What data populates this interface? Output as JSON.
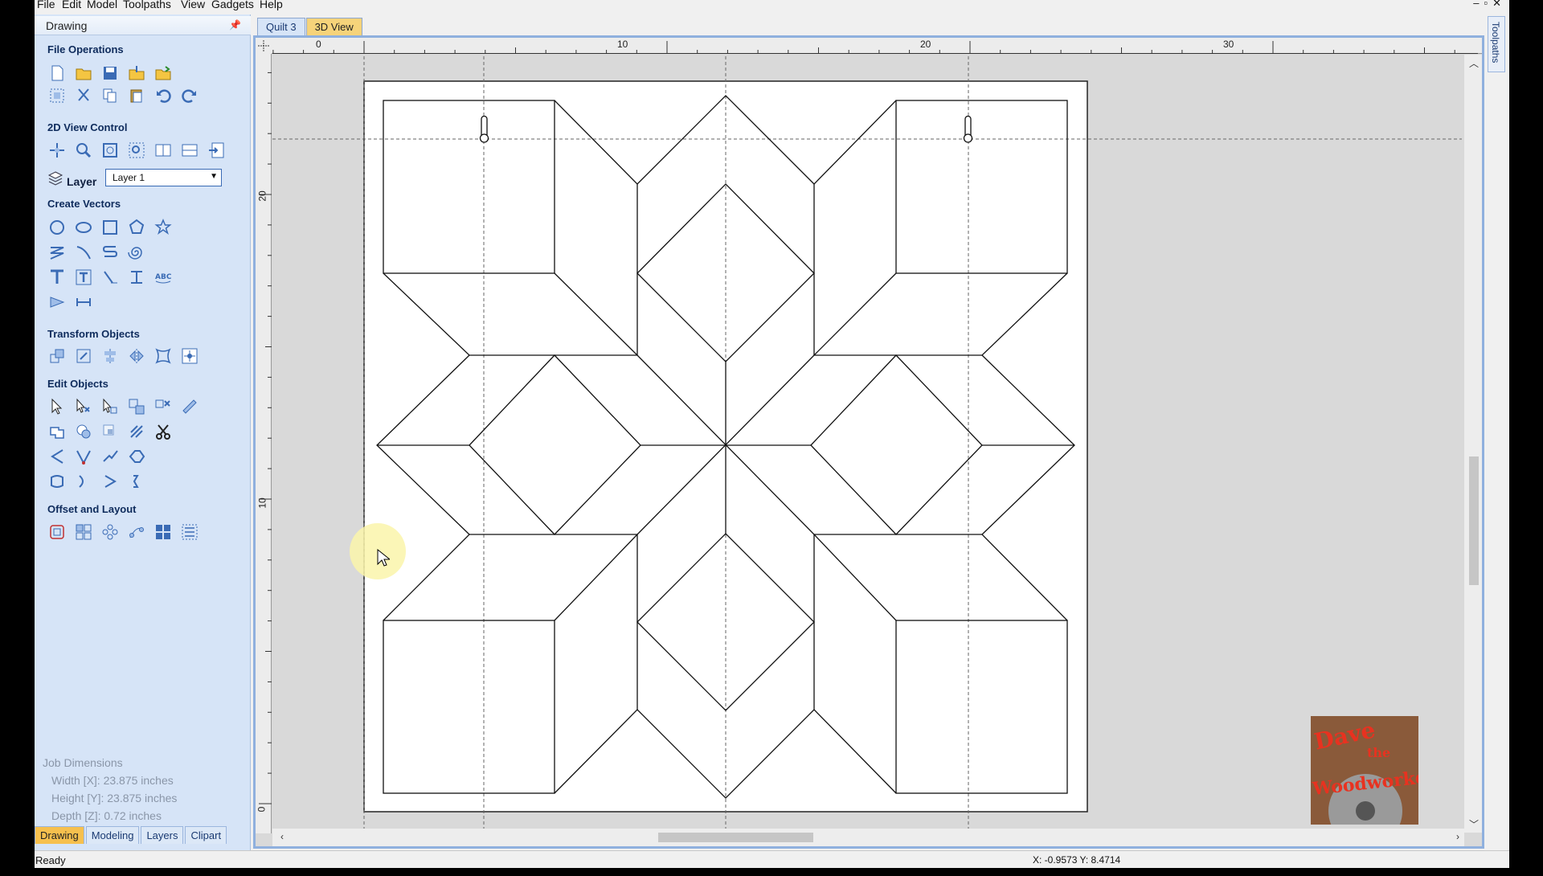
{
  "menu": [
    "File",
    "Edit",
    "Model",
    "Toolpaths",
    "View",
    "Gadgets",
    "Help"
  ],
  "panel": {
    "title": "Drawing",
    "sections": {
      "file_ops": "File Operations",
      "view_2d": "2D View Control",
      "create_vectors": "Create Vectors",
      "transform": "Transform Objects",
      "edit_objects": "Edit Objects",
      "offset_layout": "Offset and Layout"
    },
    "layer_label": "Layer",
    "layer_value": "Layer 1",
    "job_dimensions": {
      "title": "Job Dimensions",
      "width": "Width  [X]: 23.875 inches",
      "height": "Height [Y]: 23.875 inches",
      "depth": "Depth  [Z]: 0.72 inches"
    },
    "tabs": [
      "Drawing",
      "Modeling",
      "Layers",
      "Clipart"
    ]
  },
  "doc_tabs": [
    "Quilt 3",
    "3D View"
  ],
  "right_tab": "Toolpaths",
  "ruler": {
    "top": [
      "0",
      "10",
      "20",
      "30"
    ],
    "left": [
      "20",
      "10",
      "0"
    ]
  },
  "status": {
    "ready": "Ready",
    "coords": "X: -0.9573 Y:  8.4714"
  },
  "logo": {
    "line1": "Dave",
    "line2": "the",
    "line3": "Woodworker"
  },
  "colors": {
    "panel_bg": "#d6e4f7",
    "accent_tab": "#f6c04e",
    "frame": "#8fb0de"
  }
}
